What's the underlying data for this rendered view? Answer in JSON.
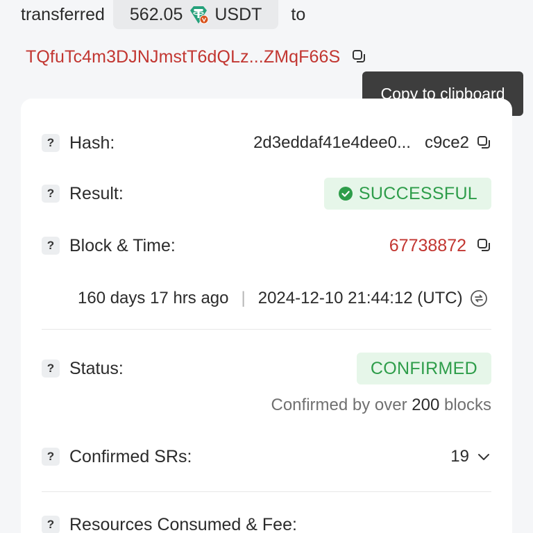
{
  "summary": {
    "prefix": "transferred",
    "amount": "562.05",
    "token_icon": "tether-usdt-icon",
    "token_symbol": "USDT",
    "suffix": "to"
  },
  "recipient": {
    "address": "TQfuTc4m3DJNJmstT6dQLz...ZMqF66S"
  },
  "tooltip": {
    "text": "Copy to clipboard"
  },
  "details": {
    "hash": {
      "help": "?",
      "label": "Hash:",
      "value_start": "2d3eddaf41e4dee0...",
      "value_end": "c9ce2"
    },
    "result": {
      "help": "?",
      "label": "Result:",
      "value": "SUCCESSFUL"
    },
    "block": {
      "help": "?",
      "label": "Block & Time:",
      "number": "67738872",
      "age": "160 days 17 hrs ago",
      "separator": "|",
      "timestamp": "2024-12-10 21:44:12 (UTC)"
    },
    "status": {
      "help": "?",
      "label": "Status:",
      "value": "CONFIRMED",
      "note_prefix": "Confirmed by over",
      "note_count": "200",
      "note_suffix": "blocks"
    },
    "confirmed_srs": {
      "help": "?",
      "label": "Confirmed SRs:",
      "value": "19"
    },
    "resources": {
      "help": "?",
      "label": "Resources Consumed & Fee:"
    }
  },
  "colors": {
    "link_red": "#c23631",
    "success_green": "#2e9d4a",
    "success_bg": "#e6f6e9",
    "tooltip_bg": "#3d3d3d",
    "usdt_teal": "#26a17b",
    "tron_orange": "#d9541e"
  }
}
